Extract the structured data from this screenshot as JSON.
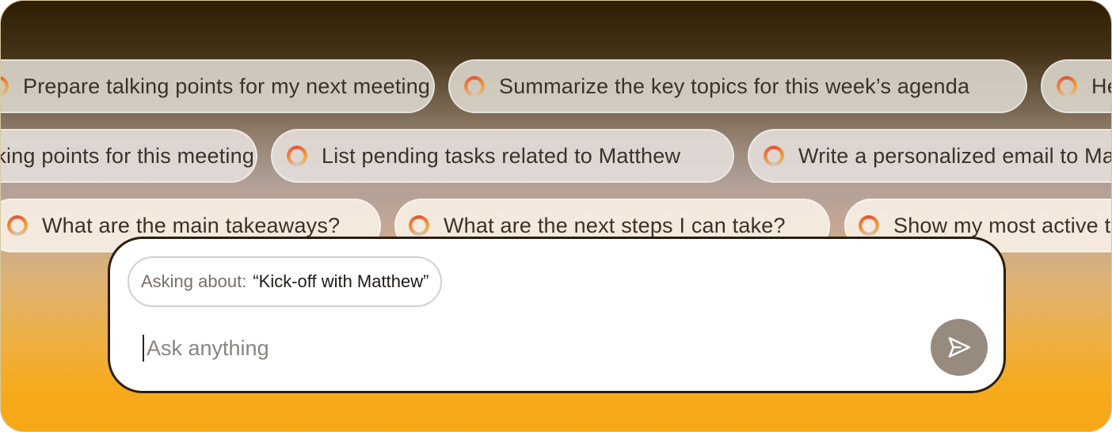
{
  "suggestions": {
    "row1": [
      {
        "label": "Prepare talking points for my next meeting",
        "icon": "spinner-ring-icon"
      },
      {
        "label": "Summarize the key topics for this week’s agenda",
        "icon": "spinner-ring-icon"
      },
      {
        "label": "Help",
        "icon": "spinner-ring-icon"
      }
    ],
    "row2": [
      {
        "label": "Suggest talking points for this meeting",
        "icon": "spinner-ring-icon"
      },
      {
        "label": "List pending tasks related to Matthew",
        "icon": "spinner-ring-icon"
      },
      {
        "label": "Write a personalized email to Matthew",
        "icon": "spinner-ring-icon"
      }
    ],
    "row3": [
      {
        "label": "What are the main takeaways?",
        "icon": "spinner-ring-icon"
      },
      {
        "label": "What are the next steps I can take?",
        "icon": "spinner-ring-icon"
      },
      {
        "label": "Show my most active topics",
        "icon": "spinner-ring-icon"
      }
    ]
  },
  "composer": {
    "context_label": "Asking about:",
    "context_value": "“Kick-off with Matthew”",
    "placeholder": "Ask anything",
    "value": "",
    "send_icon": "send-arrow-icon"
  },
  "colors": {
    "gradient_top": "#2e1f04",
    "gradient_bottom": "#f8a816",
    "panel_border": "#2b1d0e",
    "send_button": "#978b80"
  }
}
